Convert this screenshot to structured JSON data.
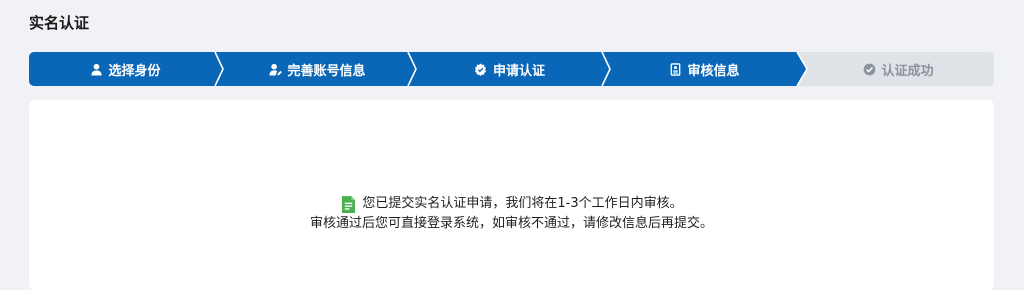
{
  "page": {
    "title": "实名认证"
  },
  "steps": [
    {
      "label": "选择身份",
      "icon": "user-icon",
      "status": "completed"
    },
    {
      "label": "完善账号信息",
      "icon": "user-edit-icon",
      "status": "completed"
    },
    {
      "label": "申请认证",
      "icon": "shield-badge-icon",
      "status": "completed"
    },
    {
      "label": "审核信息",
      "icon": "id-card-icon",
      "status": "current"
    },
    {
      "label": "认证成功",
      "icon": "check-circle-icon",
      "status": "pending"
    }
  ],
  "message": {
    "line1": "您已提交实名认证申请，我们将在1-3个工作日内审核。",
    "line2": "审核通过后您可直接登录系统，如审核不通过，请修改信息后再提交。",
    "icon": "document-icon"
  },
  "colors": {
    "step_active": "#0a67b8",
    "step_pending": "#dfe3e8",
    "doc_icon": "#4caf50",
    "background": "#f0f2f5"
  }
}
